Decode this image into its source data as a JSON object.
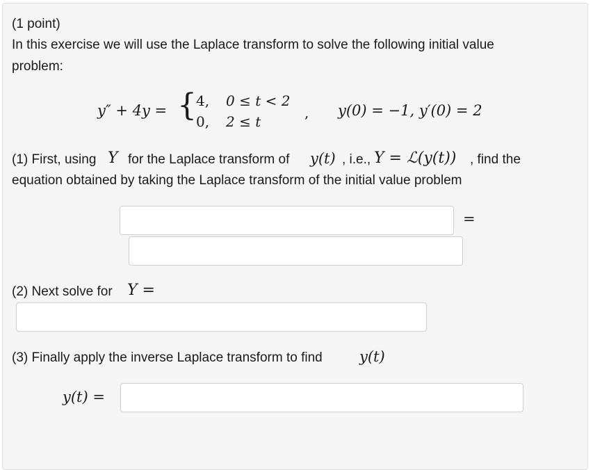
{
  "problem": {
    "points": "(1 point)",
    "intro_line1": "In this exercise we will use the Laplace transform to solve the following initial value",
    "intro_line2": "problem:",
    "equation": {
      "lhs": "y″ + 4y =",
      "case1_value": "4,",
      "case1_condition": "0 ≤ t < 2",
      "case2_value": "0,",
      "case2_condition": "2 ≤ t",
      "separator": ",",
      "initial_conditions": "y(0) = −1, y′(0) = 2"
    }
  },
  "part1": {
    "text_before": "(1) First, using",
    "var_Y": "Y",
    "text_mid1": "for the Laplace transform of",
    "y_of_t": "y(t)",
    "text_mid2": ", i.e.,",
    "Y_eq_L": "Y = ℒ(y(t))",
    "text_after": ", find the",
    "line2": "equation obtained by taking the Laplace transform of the initial value problem",
    "equals": "=",
    "input_lhs_value": "",
    "input_rhs_value": ""
  },
  "part2": {
    "text": "(2) Next solve for",
    "var": "Y =",
    "input_value": ""
  },
  "part3": {
    "text": "(3) Finally apply the inverse Laplace transform to find",
    "var": "y(t)",
    "label": "y(t) =",
    "input_value": ""
  }
}
